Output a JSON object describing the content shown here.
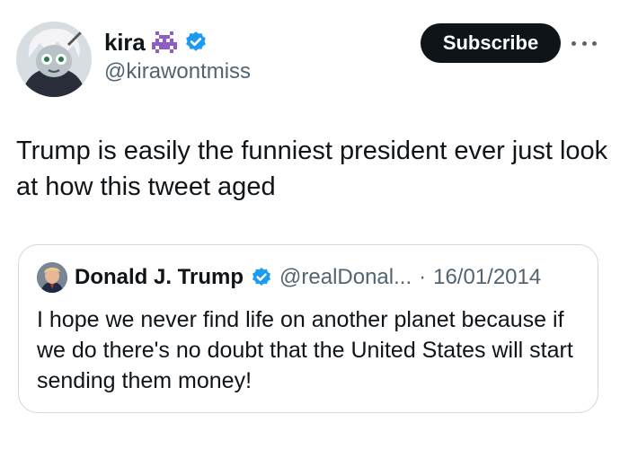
{
  "author": {
    "display_name": "kira",
    "handle": "@kirawontmiss",
    "emoji_icon": "alien-monster-emoji",
    "verified_icon": "verified-badge-icon",
    "verified_color": "#1d9bf0"
  },
  "subscribe_label": "Subscribe",
  "more_icon": "more-options-icon",
  "tweet_text": "Trump is easily the funniest president ever just look at how this tweet aged",
  "quoted_tweet": {
    "display_name": "Donald J. Trump",
    "handle": "@realDonal...",
    "separator": "·",
    "date": "16/01/2014",
    "text": "I hope we never find life on another planet because if we do there's no doubt that the United States will start sending them money!"
  }
}
